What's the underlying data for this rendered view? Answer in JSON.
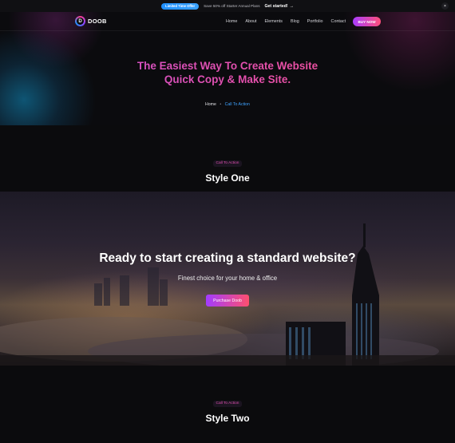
{
  "promo": {
    "badge": "Limited Time Offer",
    "text": "Save 50% off Starter Annual Plans",
    "link": "Get started!",
    "link_arrow": "→",
    "close": "×"
  },
  "header": {
    "logo_letter": "D",
    "logo_text": "DOOB",
    "nav": [
      "Home",
      "About",
      "Elements",
      "Blog",
      "Portfolio",
      "Contact"
    ],
    "buy_button": "BUY NOW"
  },
  "hero": {
    "title_line1": "The Easiest Way To Create Website",
    "title_line2": "Quick Copy & Make Site.",
    "breadcrumb_home": "Home",
    "breadcrumb_sep": "•",
    "breadcrumb_current": "Call To Action"
  },
  "section1": {
    "pill": "Call To Action",
    "title": "Style One"
  },
  "cta": {
    "title": "Ready to start creating a standard website?",
    "subtitle": "Finest choice for your home & office",
    "button": "Purchase Doob"
  },
  "section2": {
    "pill": "Call To Action",
    "title": "Style Two"
  },
  "colors": {
    "accent_pink": "#ff4f8c",
    "accent_purple": "#a93cff",
    "accent_blue": "#3fa3ff",
    "background": "#0b0b0d"
  }
}
